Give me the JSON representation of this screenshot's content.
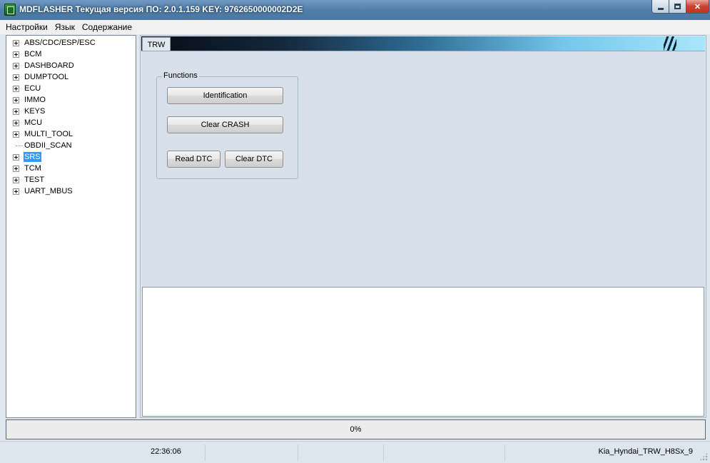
{
  "window": {
    "title": "MDFLASHER  Текущая версия ПО: 2.0.1.159  KEY: 9762650000002D2E"
  },
  "menu": {
    "items": [
      "Настройки",
      "Язык",
      "Содержание"
    ]
  },
  "tree": {
    "items": [
      {
        "label": "ABS/CDC/ESP/ESC",
        "expandable": true
      },
      {
        "label": "BCM",
        "expandable": true
      },
      {
        "label": "DASHBOARD",
        "expandable": true
      },
      {
        "label": "DUMPTOOL",
        "expandable": true
      },
      {
        "label": "ECU",
        "expandable": true
      },
      {
        "label": "IMMO",
        "expandable": true
      },
      {
        "label": "KEYS",
        "expandable": true
      },
      {
        "label": "MCU",
        "expandable": true
      },
      {
        "label": "MULTI_TOOL",
        "expandable": true
      },
      {
        "label": "OBDII_SCAN",
        "expandable": false
      },
      {
        "label": "SRS",
        "expandable": true,
        "selected": true
      },
      {
        "label": "TCM",
        "expandable": true
      },
      {
        "label": "TEST",
        "expandable": true
      },
      {
        "label": "UART_MBUS",
        "expandable": true
      }
    ]
  },
  "tab": {
    "label": "TRW"
  },
  "functions": {
    "group_label": "Functions",
    "identification_label": "Identification",
    "clear_crash_label": "Clear CRASH",
    "read_dtc_label": "Read DTC",
    "clear_dtc_label": "Clear DTC"
  },
  "progress": {
    "text": "0%",
    "value": 0
  },
  "status": {
    "time": "22:36:06",
    "model": "Kia_Hyndai_TRW_H8Sx_9"
  },
  "colors": {
    "selection": "#3399ff",
    "title_bar": "#4f7ea9",
    "close_button": "#c7432f"
  }
}
